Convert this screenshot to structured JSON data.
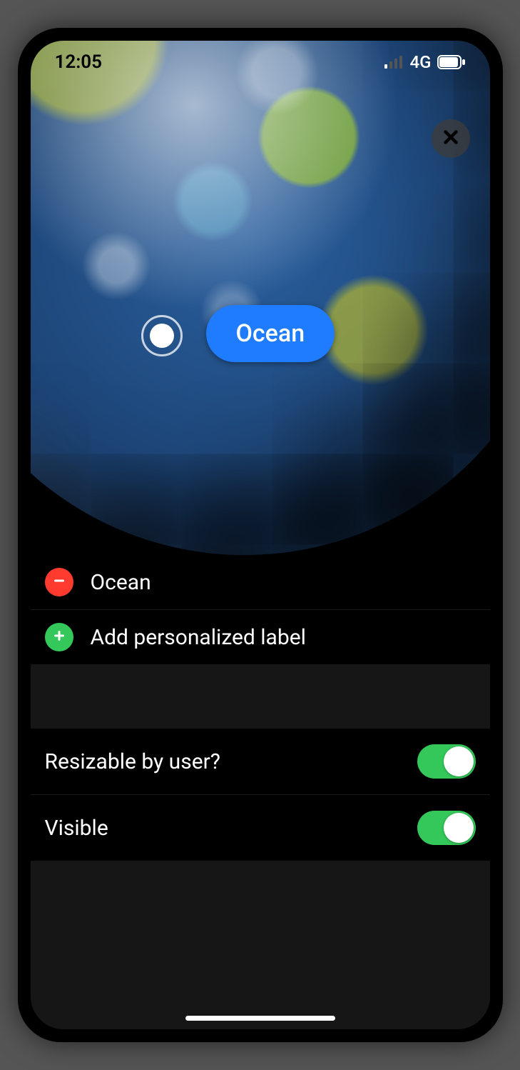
{
  "status": {
    "time": "12:05",
    "network": "4G"
  },
  "preview": {
    "label_text": "Ocean"
  },
  "labels": {
    "items": [
      {
        "text": "Ocean"
      }
    ],
    "add_label": "Add personalized label"
  },
  "settings": {
    "resizable": {
      "label": "Resizable by user?",
      "on": true
    },
    "visible": {
      "label": "Visible",
      "on": true
    }
  }
}
